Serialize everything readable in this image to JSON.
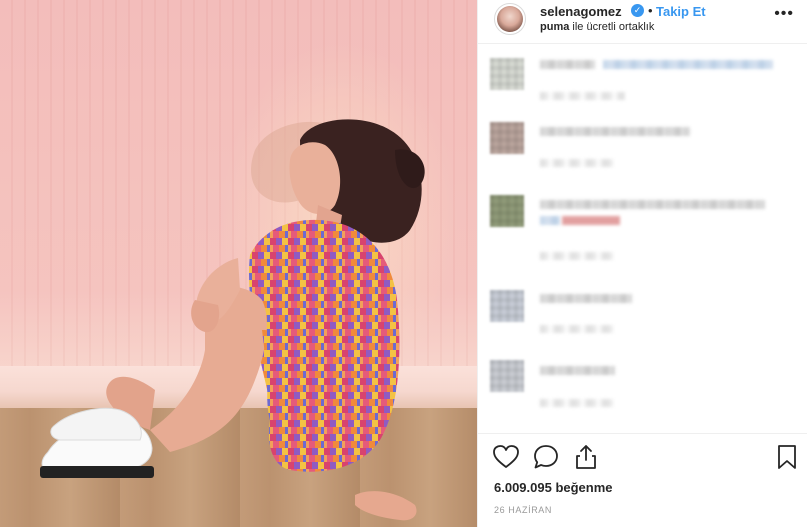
{
  "post": {
    "image_alt": "",
    "header": {
      "username": "selenagomez",
      "verified_icon": "verified-badge-icon",
      "separator": "•",
      "follow_label": "Takip Et",
      "partnership_brand": "puma",
      "partnership_text": " ile ücretli ortaklık",
      "more_icon": "more-options-icon",
      "more_glyph": "•••"
    },
    "actions": {
      "like_icon": "heart-icon",
      "comment_icon": "comment-bubble-icon",
      "share_icon": "share-icon",
      "save_icon": "bookmark-icon"
    },
    "likes": "6.009.095 beğenme",
    "date": "26 HAZİRAN"
  },
  "colors": {
    "accent": "#3897f0",
    "text": "#262626",
    "muted": "#999999",
    "border": "#efefef"
  }
}
